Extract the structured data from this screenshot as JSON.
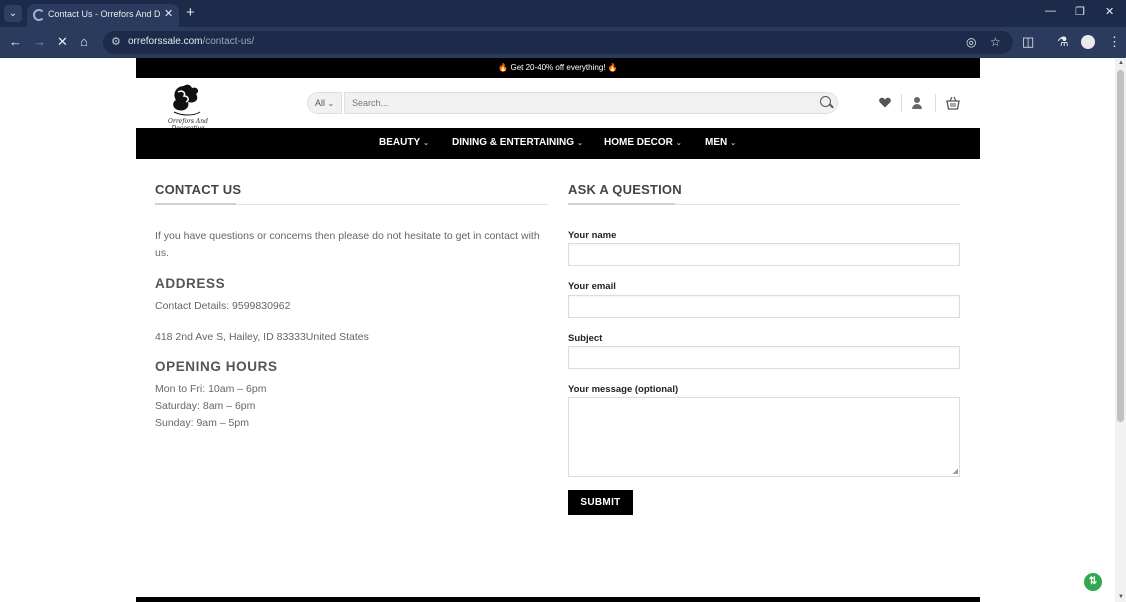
{
  "browser": {
    "tab_title": "Contact Us - Orrefors And Decorative",
    "url_host": "orreforssale.com",
    "url_path": "/contact-us/",
    "icons": [
      "tab-search-icon",
      "new-tab-icon",
      "minimize-icon",
      "restore-icon",
      "close-window-icon",
      "back-icon",
      "forward-icon",
      "stop-icon",
      "home-icon",
      "site-info-icon",
      "eye-off-icon",
      "bookmark-star-icon",
      "extensions-icon",
      "labs-icon",
      "profile-icon",
      "menu-icon"
    ]
  },
  "site": {
    "promo": "🔥 Get 20-40% off everything! 🔥",
    "logo_text": "Orrefors And Decorative",
    "search_category": "All",
    "search_placeholder": "Search...",
    "nav": [
      {
        "label": "BEAUTY"
      },
      {
        "label": "DINING & ENTERTAINING"
      },
      {
        "label": "HOME DECOR"
      },
      {
        "label": "MEN"
      }
    ]
  },
  "contact": {
    "title": "CONTACT US",
    "intro": "If you have questions or concerns then please do not hesitate to get in contact with us.",
    "address_heading": "ADDRESS",
    "contact_details": "Contact Details: 9599830962",
    "address_line": "418 2nd Ave S, Hailey, ID 83333United States",
    "hours_heading": "OPENING HOURS",
    "hours": [
      "Mon to Fri: 10am – 6pm",
      "Saturday: 8am – 6pm",
      "Sunday: 9am – 5pm"
    ]
  },
  "form": {
    "title": "ASK A QUESTION",
    "name_label": "Your name",
    "email_label": "Your email",
    "subject_label": "Subject",
    "message_label": "Your message (optional)",
    "submit_label": "SUBMIT"
  },
  "colors": {
    "browser_frame": "#1c2b4a",
    "nav_bg": "#000000",
    "badge_green": "#2fa84f"
  }
}
